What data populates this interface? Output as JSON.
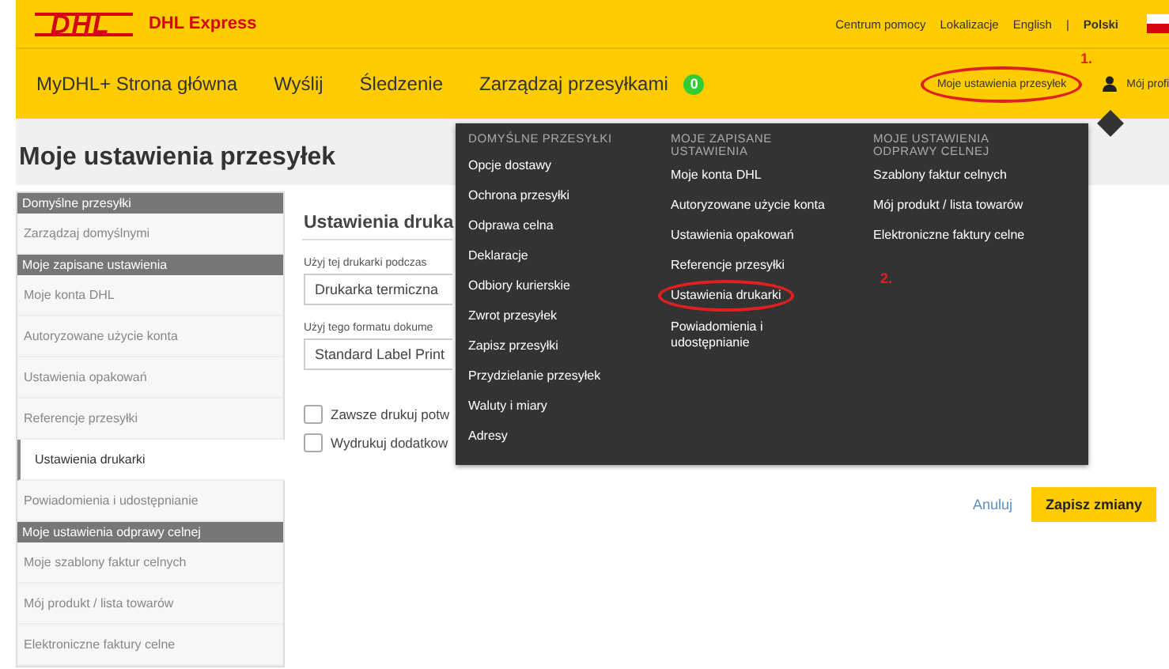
{
  "header": {
    "logo": "DHL",
    "brand": "DHL Express",
    "links": [
      {
        "label": "Centrum pomocy",
        "kind": "link"
      },
      {
        "label": "Lokalizacje",
        "kind": "link"
      },
      {
        "label": "English",
        "kind": "lang",
        "selected": false
      },
      {
        "label": "|",
        "kind": "sep"
      },
      {
        "label": "Polski",
        "kind": "lang",
        "selected": true
      }
    ]
  },
  "nav": {
    "items": [
      {
        "label": "MyDHL+ Strona główna"
      },
      {
        "label": "Wyślij"
      },
      {
        "label": "Śledzenie"
      },
      {
        "label": "Zarządzaj przesyłkami",
        "badge": "0"
      }
    ],
    "settings": {
      "label": "Moje ustawienia przesyłek",
      "annotation": "1."
    },
    "profile": "Mój profi"
  },
  "page_title": "Moje ustawienia przesyłek",
  "sidebar": [
    {
      "kind": "header",
      "label": "Domyślne przesyłki"
    },
    {
      "kind": "item",
      "label": "Zarządzaj domyślnymi",
      "selected": false
    },
    {
      "kind": "header",
      "label": "Moje zapisane ustawienia"
    },
    {
      "kind": "item",
      "label": "Moje konta DHL",
      "selected": false
    },
    {
      "kind": "item",
      "label": "Autoryzowane użycie konta",
      "selected": false
    },
    {
      "kind": "item",
      "label": "Ustawienia opakowań",
      "selected": false
    },
    {
      "kind": "item",
      "label": "Referencje przesyłki",
      "selected": false
    },
    {
      "kind": "item",
      "label": "Ustawienia drukarki",
      "selected": true
    },
    {
      "kind": "item",
      "label": "Powiadomienia i udostępnianie",
      "selected": false
    },
    {
      "kind": "header",
      "label": "Moje ustawienia odprawy celnej"
    },
    {
      "kind": "item",
      "label": "Moje szablony faktur celnych",
      "selected": false
    },
    {
      "kind": "item",
      "label": "Mój produkt / lista towarów",
      "selected": false
    },
    {
      "kind": "item",
      "label": "Elektroniczne faktury celne",
      "selected": false
    }
  ],
  "printer": {
    "title": "Ustawienia druka",
    "fields": [
      {
        "label": "Użyj tej drukarki podczas",
        "value": "Drukarka termiczna"
      },
      {
        "label": "Użyj tego formatu dokume",
        "value": "Standard Label Print"
      }
    ],
    "checkboxes": [
      {
        "label": "Zawsze drukuj potw",
        "checked": false
      },
      {
        "label": "Wydrukuj dodatkow",
        "checked": false
      }
    ],
    "cancel": "Anuluj",
    "save": "Zapisz zmiany"
  },
  "menu": {
    "columns": [
      {
        "heading": "DOMYŚLNE PRZESYŁKI",
        "items": [
          {
            "label": "Opcje dostawy"
          },
          {
            "label": "Ochrona przesyłki"
          },
          {
            "label": "Odprawa celna"
          },
          {
            "label": "Deklaracje"
          },
          {
            "label": "Odbiory kurierskie"
          },
          {
            "label": "Zwrot przesyłek"
          },
          {
            "label": "Zapisz przesyłki"
          },
          {
            "label": "Przydzielanie przesyłek"
          },
          {
            "label": "Waluty i miary"
          },
          {
            "label": "Adresy"
          }
        ]
      },
      {
        "heading": "MOJE ZAPISANE USTAWIENIA",
        "items": [
          {
            "label": "Moje konta DHL"
          },
          {
            "label": "Autoryzowane użycie konta"
          },
          {
            "label": "Ustawienia opakowań"
          },
          {
            "label": "Referencje przesyłki"
          },
          {
            "label": "Ustawienia drukarki",
            "annotation": "2."
          },
          {
            "label": "Powiadomienia i udostępnianie"
          }
        ]
      },
      {
        "heading": "MOJE USTAWIENIA ODPRAWY CELNEJ",
        "items": [
          {
            "label": "Szablony faktur celnych"
          },
          {
            "label": "Mój produkt / lista towarów"
          },
          {
            "label": "Elektroniczne faktury celne"
          }
        ]
      }
    ]
  }
}
